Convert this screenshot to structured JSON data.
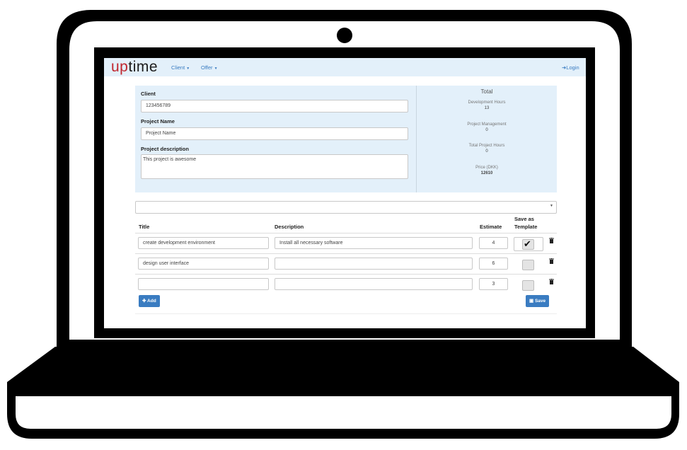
{
  "app": {
    "logo_part1": "up",
    "logo_part2": "time"
  },
  "nav": {
    "client_label": "Client",
    "offer_label": "Offer",
    "login_label": "Login"
  },
  "form": {
    "client_label": "Client",
    "client_value": "123456789",
    "project_name_label": "Project Name",
    "project_name_value": "Project Name",
    "description_label": "Project description",
    "description_value": "This project is awesome"
  },
  "totals": {
    "heading": "Total",
    "dev_hours_label": "Development Hours",
    "dev_hours_value": "13",
    "pm_label": "Project Management",
    "pm_value": "0",
    "total_hours_label": "Total Project Hours",
    "total_hours_value": "0",
    "price_label": "Price (DKK)",
    "price_value": "12610"
  },
  "table": {
    "headers": {
      "title": "Title",
      "description": "Description",
      "estimate": "Estimate",
      "save_template_line1": "Save as",
      "save_template_line2": "Template"
    },
    "rows": [
      {
        "title": "create development environment",
        "description": "Install all necessary software",
        "estimate": "4",
        "template_checked": true
      },
      {
        "title": "design user interface",
        "description": "",
        "estimate": "6",
        "template_checked": false
      },
      {
        "title": "",
        "description": "",
        "estimate": "3",
        "template_checked": false
      }
    ]
  },
  "buttons": {
    "add_label": "Add",
    "save_label": "Save"
  },
  "colors": {
    "accent": "#3a7cc1",
    "panel": "#e3f0fa",
    "logo_red": "#c0262e"
  }
}
